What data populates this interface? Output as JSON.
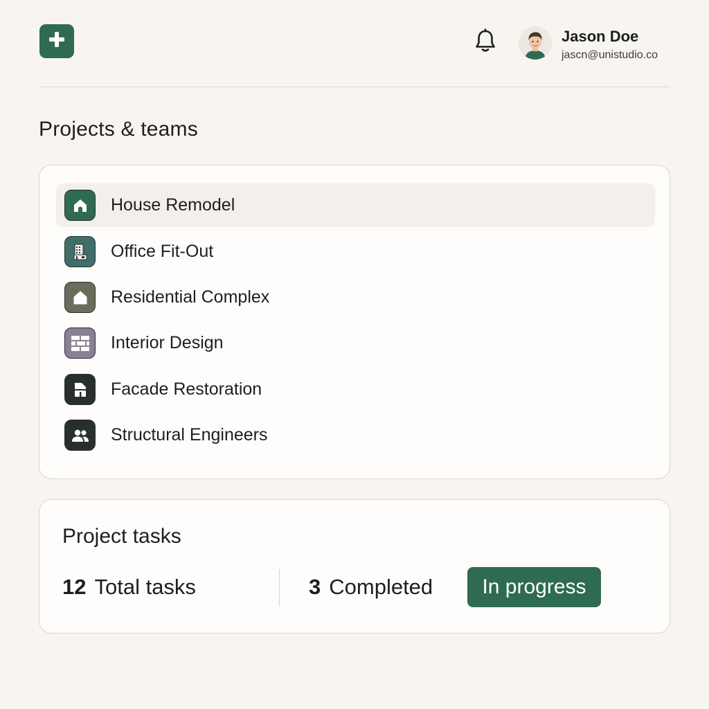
{
  "header": {
    "add_icon": "plus-icon",
    "notification_icon": "bell-icon",
    "user": {
      "name": "Jason Doe",
      "email": "jascn@unistudio.co"
    }
  },
  "projects": {
    "title": "Projects & teams",
    "items": [
      {
        "label": "House Remodel",
        "icon": "house-icon",
        "color": "#2f6b52",
        "selected": true
      },
      {
        "label": "Office Fit-Out",
        "icon": "office-building-icon",
        "color": "#3f6f6a",
        "selected": false
      },
      {
        "label": "Residential Complex",
        "icon": "home-outline-icon",
        "color": "#6b6d5c",
        "selected": false
      },
      {
        "label": "Interior Design",
        "icon": "brick-wall-icon",
        "color": "#8a7f95",
        "selected": false
      },
      {
        "label": "Facade Restoration",
        "icon": "facade-icon",
        "color": "#27302e",
        "selected": false
      },
      {
        "label": "Structural Engineers",
        "icon": "team-icon",
        "color": "#27302e",
        "selected": false
      }
    ]
  },
  "tasks": {
    "title": "Project tasks",
    "total_count": "12",
    "total_label": "Total tasks",
    "completed_count": "3",
    "completed_label": "Completed",
    "status": "In progress"
  },
  "colors": {
    "accent": "#2f6b52",
    "background": "#f8f5f1",
    "card": "#fefdfb"
  }
}
